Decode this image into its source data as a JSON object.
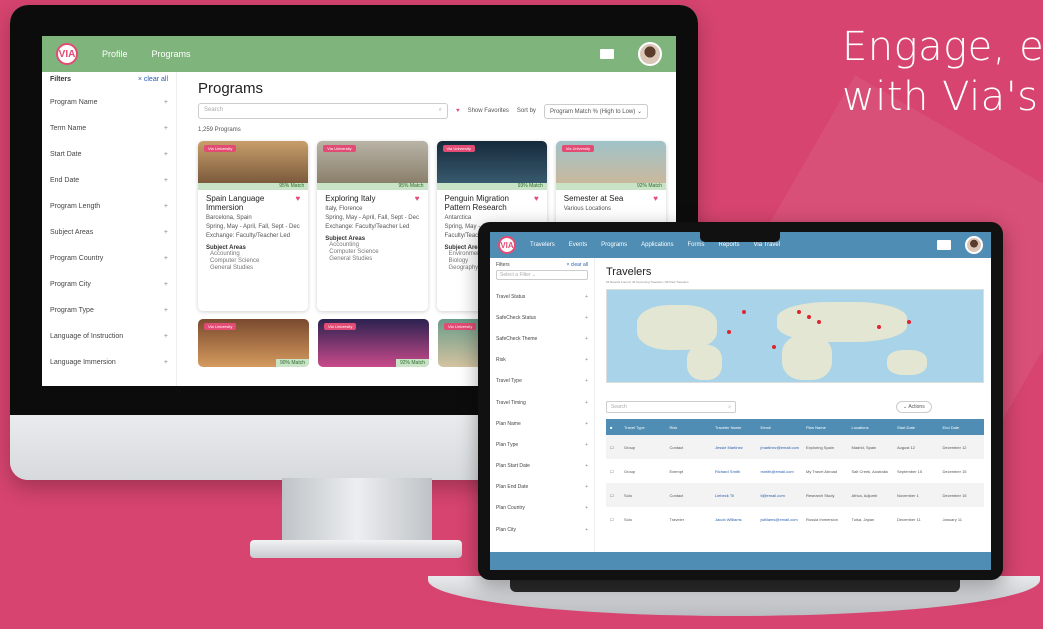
{
  "hero": {
    "line1": "Engage, e",
    "line2": "with Via's"
  },
  "desktop": {
    "logo": "VIA",
    "nav": [
      "Profile",
      "Programs"
    ],
    "filters": {
      "title": "Filters",
      "clear": "× clear all",
      "items": [
        "Program Name",
        "Term Name",
        "Start Date",
        "End Date",
        "Program Length",
        "Subject Areas",
        "Program Country",
        "Program City",
        "Program Type",
        "Language of Instruction",
        "Language Immersion"
      ]
    },
    "main": {
      "title": "Programs",
      "search_placeholder": "Search",
      "show_favorites": "Show Favorites",
      "sort_label": "Sort by",
      "sort_value": "Program Match % (High to Low)",
      "count": "1,259 Programs"
    },
    "cards": [
      {
        "tag": "Via University",
        "match": "95% Match",
        "title": "Spain Language Immersion",
        "meta": [
          "Barcelona, Spain",
          "Spring, May - April, Fall, Sept - Dec",
          "Exchange: Faculty/Teacher Led"
        ],
        "subject": "Subject Areas",
        "subjects": [
          "Accounting",
          "Computer Science",
          "General Studies"
        ]
      },
      {
        "tag": "Via University",
        "match": "95% Match",
        "title": "Exploring Italy",
        "meta": [
          "Italy, Florence",
          "Spring, May - April, Fall, Sept - Dec",
          "Exchange: Faculty/Teacher Led"
        ],
        "subject": "Subject Areas",
        "subjects": [
          "Accounting",
          "Computer Science",
          "General Studies"
        ]
      },
      {
        "tag": "Via University",
        "match": "93% Match",
        "title": "Penguin Migration Pattern Research",
        "meta": [
          "Antarctica",
          "Spring, May - April",
          "Faculty/Teacher Led"
        ],
        "subject": "Subject Areas",
        "subjects": [
          "Environmental",
          "Biology",
          "Geography"
        ]
      },
      {
        "tag": "Via University",
        "match": "92% Match",
        "title": "Semester at Sea",
        "meta": [
          "Various Locations"
        ],
        "subject": "",
        "subjects": []
      }
    ],
    "cards2": [
      {
        "tag": "Via University",
        "match": "90% Match"
      },
      {
        "tag": "Via University",
        "match": "92% Match"
      },
      {
        "tag": "Via University",
        "match": ""
      }
    ]
  },
  "laptop": {
    "logo": "VIA",
    "nav": [
      "Travelers",
      "Events",
      "Programs",
      "Applications",
      "Forms",
      "Reports",
      "Via Travel"
    ],
    "filters": {
      "title": "Filters",
      "clear": "× clear all",
      "select": "Select a Filter",
      "items": [
        "Travel Status",
        "SafeCheck Status",
        "SafeCheck Theme",
        "Risk",
        "Travel Type",
        "Travel Timing",
        "Plan Name",
        "Plan Type",
        "Plan Start Date",
        "Plan End Date",
        "Plan Country",
        "Plan City"
      ]
    },
    "title": "Travelers",
    "subtitle": "93 Results Found | 46 Upcoming Travelers | 66 Past Travelers",
    "search_placeholder": "Search",
    "actions": "Actions",
    "table": {
      "headers": [
        "Travel Type",
        "Risk",
        "Traveler Name",
        "Email",
        "Plan Name",
        "Locations",
        "Start Date",
        "End Date"
      ],
      "rows": [
        [
          "Group",
          "Contact",
          "Jessie Martinez",
          "jmartinez@email.com",
          "Exploring Spain",
          "Madrid, Spain",
          "August 12",
          "December 12"
        ],
        [
          "Group",
          "Exempt",
          "Richard Smith",
          "rsmith@email.com",
          "My Travel Abroad",
          "Salt Creek, Australia",
          "September 15",
          "December 15"
        ],
        [
          "Solo",
          "Contact",
          "Liebeck Til",
          "tl@email.com",
          "Research Study",
          "Africa, Adjumb",
          "November 1",
          "December 15"
        ],
        [
          "Solo",
          "Traveler",
          "Jacob Williams",
          "jwilliams@email.com",
          "Russia Immersion",
          "Tulsa, Japan",
          "December 11",
          "January 11"
        ]
      ]
    }
  }
}
